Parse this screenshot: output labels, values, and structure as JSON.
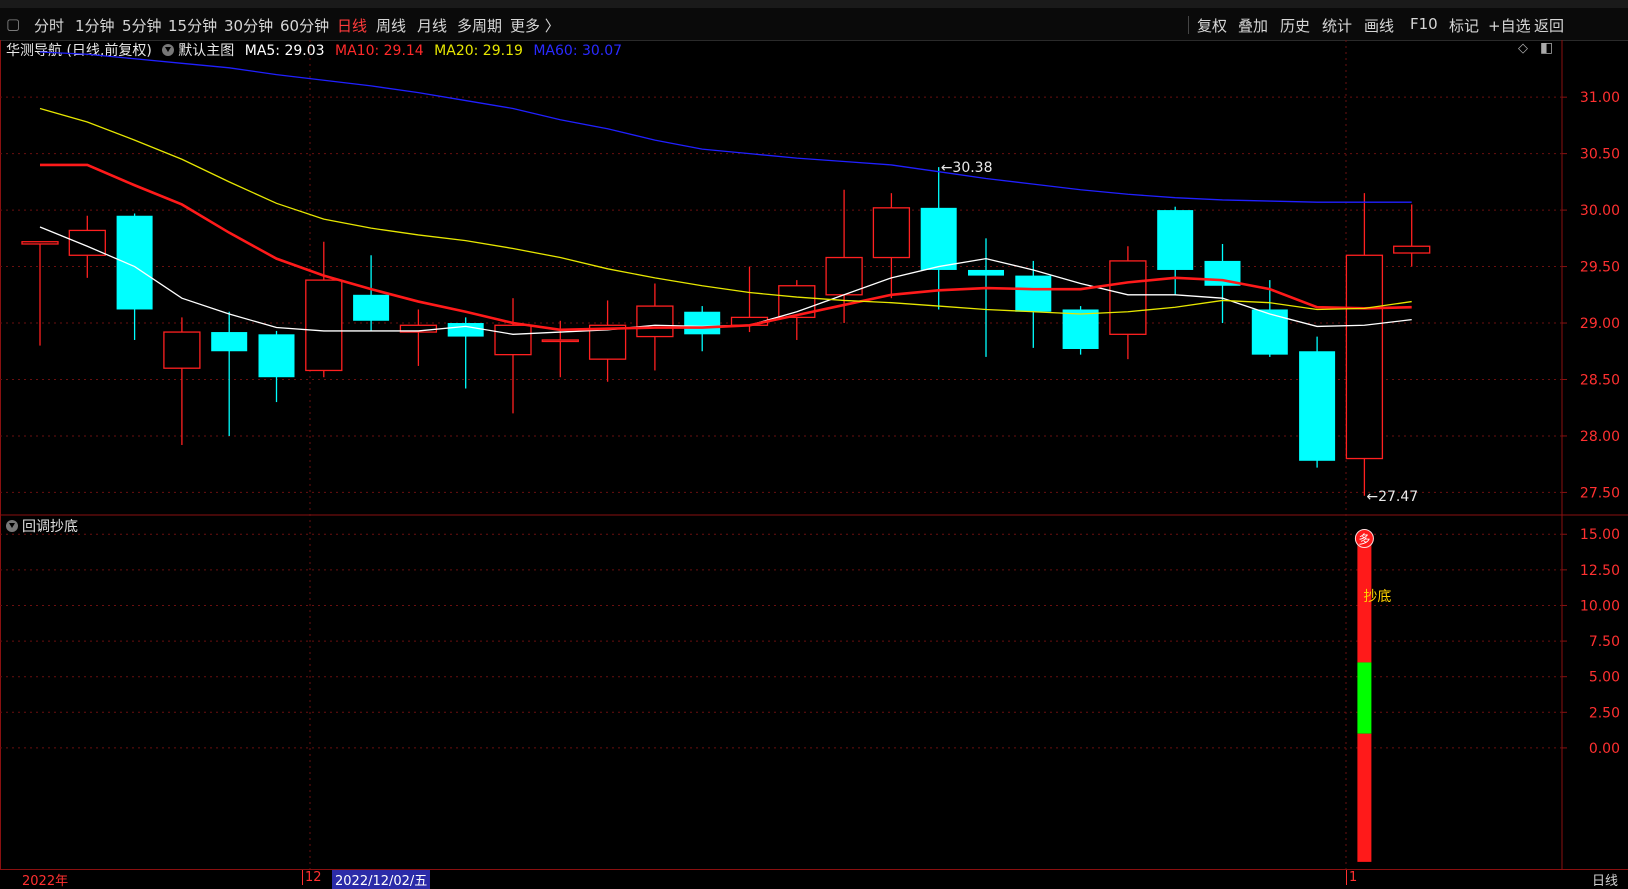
{
  "toolbar": {
    "periods": [
      "分时",
      "1分钟",
      "5分钟",
      "15分钟",
      "30分钟",
      "60分钟",
      "日线",
      "周线",
      "月线",
      "多周期",
      "更多 〉"
    ],
    "active_period": "日线",
    "right_buttons": [
      "复权",
      "叠加",
      "历史",
      "统计",
      "画线",
      "F10",
      "标记",
      "+自选",
      "返回"
    ]
  },
  "main_title": {
    "stock": "华测导航 (日线,前复权)",
    "template": "默认主图",
    "ma5": "MA5: 29.03",
    "ma10": "MA10: 29.14",
    "ma20": "MA20: 29.19",
    "ma60": "MA60: 30.07"
  },
  "sub_title": "回调抄底",
  "colors": {
    "up": "#ff2020",
    "down": "#00ffff",
    "ma5": "#ffffff",
    "ma10": "#ff1a1a",
    "ma20": "#e6e600",
    "ma60": "#2020ff",
    "grid": "#6a0f0f",
    "axis_text": "#ff3030"
  },
  "bottom": {
    "year_label": "2022年",
    "month_label": "12",
    "date_label": "2022/12/02/五",
    "month_label2": "1",
    "period_label": "日线"
  },
  "chart_data": [
    {
      "type": "candlestick",
      "title": "华测导航 (日线,前复权)",
      "ylim": [
        27.3,
        31.4
      ],
      "yticks": [
        31.0,
        30.5,
        30.0,
        29.5,
        29.0,
        28.5,
        28.0,
        27.5
      ],
      "ytick_labels": [
        "31.00",
        "30.50",
        "30.00",
        "29.50",
        "29.00",
        "28.50",
        "28.00",
        "27.50"
      ],
      "annotations": [
        {
          "text": "30.38",
          "value": 30.38,
          "index": 19
        },
        {
          "text": "27.47",
          "value": 27.47,
          "index": 28
        }
      ],
      "candles": [
        {
          "o": 29.7,
          "h": 29.72,
          "l": 28.8,
          "c": 29.72
        },
        {
          "o": 29.6,
          "h": 29.95,
          "l": 29.4,
          "c": 29.82
        },
        {
          "o": 29.95,
          "h": 29.97,
          "l": 28.85,
          "c": 29.12
        },
        {
          "o": 28.6,
          "h": 29.05,
          "l": 27.92,
          "c": 28.92
        },
        {
          "o": 28.92,
          "h": 29.1,
          "l": 28.0,
          "c": 28.75
        },
        {
          "o": 28.9,
          "h": 28.93,
          "l": 28.3,
          "c": 28.52
        },
        {
          "o": 28.58,
          "h": 29.72,
          "l": 28.52,
          "c": 29.38
        },
        {
          "o": 29.25,
          "h": 29.6,
          "l": 28.93,
          "c": 29.02
        },
        {
          "o": 28.92,
          "h": 29.12,
          "l": 28.62,
          "c": 28.98
        },
        {
          "o": 29.0,
          "h": 29.05,
          "l": 28.42,
          "c": 28.88
        },
        {
          "o": 28.72,
          "h": 29.22,
          "l": 28.2,
          "c": 28.98
        },
        {
          "o": 28.85,
          "h": 29.02,
          "l": 28.52,
          "c": 28.85
        },
        {
          "o": 28.68,
          "h": 29.2,
          "l": 28.48,
          "c": 28.98
        },
        {
          "o": 28.88,
          "h": 29.35,
          "l": 28.58,
          "c": 29.15
        },
        {
          "o": 29.1,
          "h": 29.15,
          "l": 28.75,
          "c": 28.9
        },
        {
          "o": 28.98,
          "h": 29.5,
          "l": 28.92,
          "c": 29.05
        },
        {
          "o": 29.05,
          "h": 29.38,
          "l": 28.85,
          "c": 29.33
        },
        {
          "o": 29.25,
          "h": 30.18,
          "l": 29.0,
          "c": 29.58
        },
        {
          "o": 29.58,
          "h": 30.15,
          "l": 29.22,
          "c": 30.02
        },
        {
          "o": 30.02,
          "h": 30.38,
          "l": 29.12,
          "c": 29.47
        },
        {
          "o": 29.47,
          "h": 29.75,
          "l": 28.7,
          "c": 29.42
        },
        {
          "o": 29.42,
          "h": 29.55,
          "l": 28.78,
          "c": 29.1
        },
        {
          "o": 29.12,
          "h": 29.15,
          "l": 28.72,
          "c": 28.77
        },
        {
          "o": 28.9,
          "h": 29.68,
          "l": 28.68,
          "c": 29.55
        },
        {
          "o": 30.0,
          "h": 30.03,
          "l": 29.25,
          "c": 29.47
        },
        {
          "o": 29.55,
          "h": 29.7,
          "l": 29.0,
          "c": 29.33
        },
        {
          "o": 29.12,
          "h": 29.38,
          "l": 28.7,
          "c": 28.72
        },
        {
          "o": 28.75,
          "h": 28.88,
          "l": 27.72,
          "c": 27.78
        },
        {
          "o": 27.8,
          "h": 30.15,
          "l": 27.47,
          "c": 29.6
        },
        {
          "o": 29.62,
          "h": 30.05,
          "l": 29.5,
          "c": 29.68
        }
      ],
      "series": [
        {
          "name": "MA5",
          "values": [
            29.85,
            29.68,
            29.5,
            29.22,
            29.08,
            28.96,
            28.93,
            28.93,
            28.93,
            28.97,
            28.9,
            28.92,
            28.94,
            28.98,
            28.97,
            28.98,
            29.1,
            29.25,
            29.4,
            29.5,
            29.57,
            29.47,
            29.35,
            29.25,
            29.25,
            29.22,
            29.08,
            28.97,
            28.98,
            29.03
          ]
        },
        {
          "name": "MA10",
          "values": [
            30.4,
            30.4,
            30.22,
            30.05,
            29.8,
            29.57,
            29.42,
            29.3,
            29.19,
            29.1,
            29.0,
            28.94,
            28.95,
            28.96,
            28.96,
            28.98,
            29.07,
            29.16,
            29.25,
            29.29,
            29.31,
            29.3,
            29.3,
            29.36,
            29.4,
            29.38,
            29.3,
            29.14,
            29.13,
            29.14
          ]
        },
        {
          "name": "MA20",
          "values": [
            30.9,
            30.78,
            30.62,
            30.45,
            30.25,
            30.06,
            29.92,
            29.84,
            29.78,
            29.73,
            29.66,
            29.58,
            29.48,
            29.4,
            29.33,
            29.27,
            29.23,
            29.2,
            29.18,
            29.15,
            29.12,
            29.1,
            29.08,
            29.1,
            29.14,
            29.2,
            29.18,
            29.12,
            29.13,
            29.19
          ]
        },
        {
          "name": "MA60",
          "values": [
            31.4,
            31.38,
            31.34,
            31.3,
            31.26,
            31.2,
            31.15,
            31.1,
            31.04,
            30.97,
            30.9,
            30.8,
            30.72,
            30.62,
            30.54,
            30.5,
            30.46,
            30.43,
            30.4,
            30.34,
            30.28,
            30.23,
            30.18,
            30.14,
            30.11,
            30.09,
            30.08,
            30.07,
            30.07,
            30.07
          ]
        }
      ]
    },
    {
      "type": "bar",
      "title": "回调抄底",
      "ylim": [
        -8.5,
        16.0
      ],
      "yticks": [
        15.0,
        12.5,
        10.0,
        7.5,
        5.0,
        2.5,
        0.0
      ],
      "ytick_labels": [
        "15.00",
        "12.50",
        "10.00",
        "7.50",
        "5.00",
        "2.50",
        "0.00"
      ],
      "signal_index": 28,
      "segments": [
        {
          "from": 15.0,
          "to": 6.0,
          "color": "#ff1a1a"
        },
        {
          "from": 6.0,
          "to": 1.0,
          "color": "#00ff00"
        },
        {
          "from": 1.0,
          "to": -8.0,
          "color": "#ff1a1a"
        }
      ],
      "markers": {
        "top_badge": "多",
        "signal_text": "抄底"
      }
    }
  ]
}
